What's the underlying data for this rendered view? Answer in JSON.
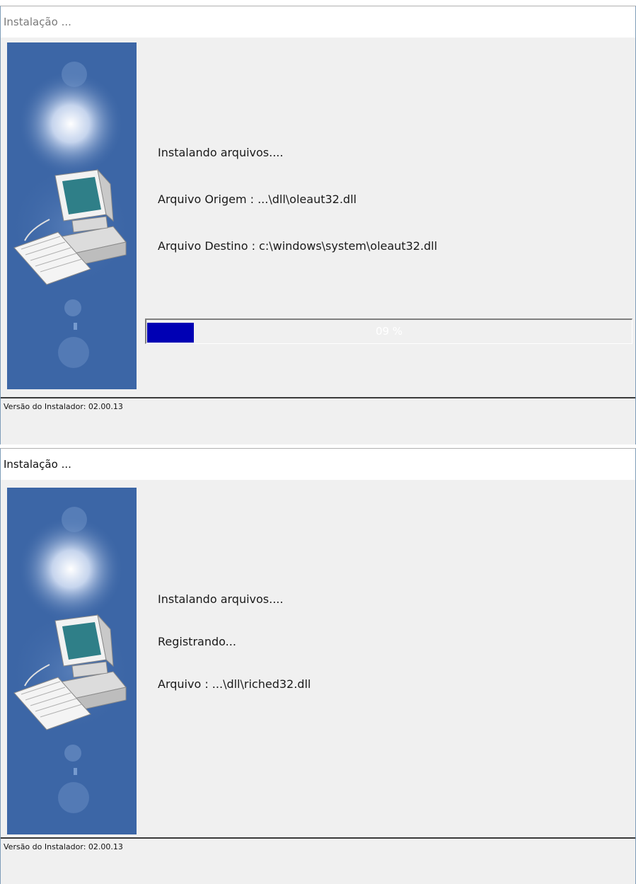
{
  "windows": [
    {
      "title": "Instalação ...",
      "lines": [
        "Instalando arquivos....",
        "Arquivo Origem : ...\\dll\\oleaut32.dll",
        "Arquivo Destino : c:\\windows\\system\\oleaut32.dll"
      ],
      "progress": {
        "label": "09 %",
        "fraction": 0.09,
        "fill_color": "#0000b4"
      },
      "status": "Versão do Instalador: 02.00.13"
    },
    {
      "title": "Instalação ...",
      "lines": [
        "Instalando arquivos....",
        "Registrando...",
        "Arquivo : ...\\dll\\riched32.dll"
      ],
      "status": "Versão do Instalador: 02.00.13"
    }
  ],
  "icons": {
    "side_image": "computer-setup-icon"
  },
  "colors": {
    "side_panel": "#3c66a6",
    "progress_fill": "#0000b4"
  }
}
